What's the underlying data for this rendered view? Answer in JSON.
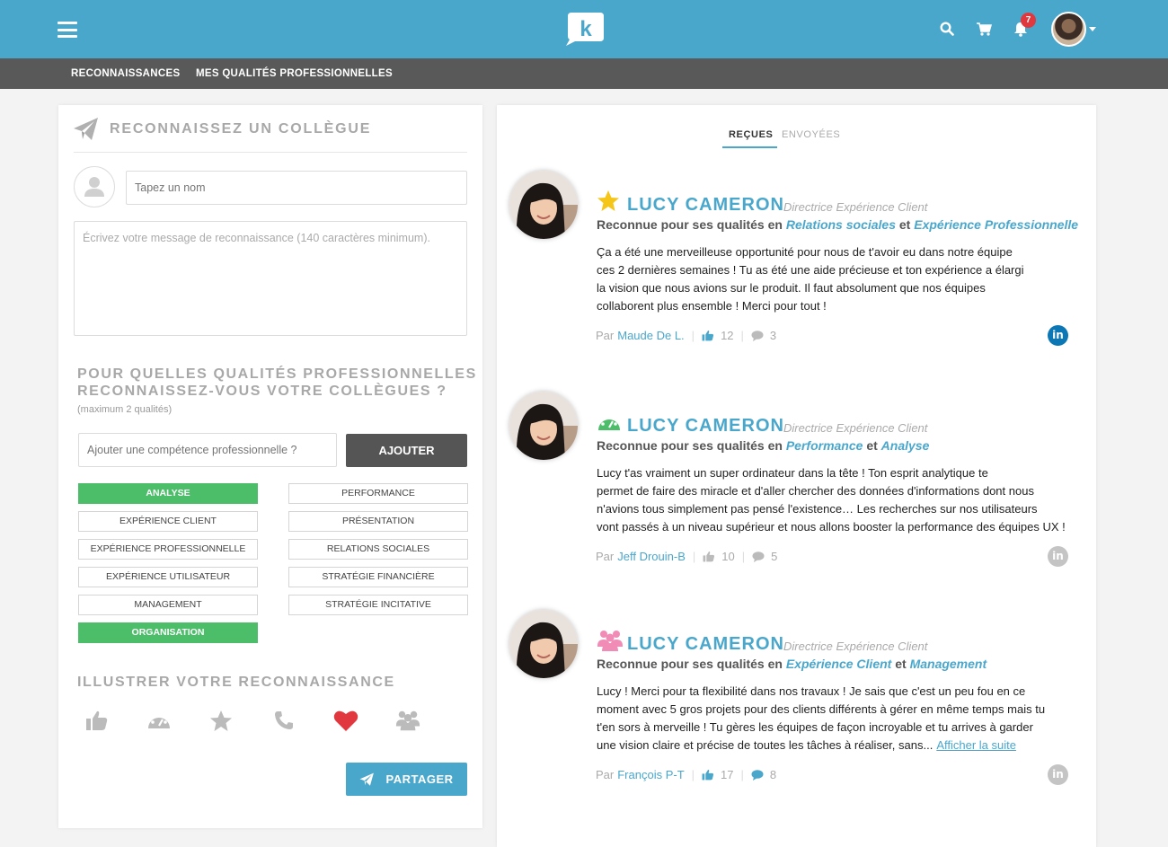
{
  "header": {
    "notifications_count": "7",
    "brand_color": "#4aa7cc",
    "logo_letter": "k"
  },
  "subnav": {
    "items": [
      "RECONNAISSANCES",
      "MES QUALITÉS PROFESSIONNELLES"
    ]
  },
  "compose": {
    "title": "RECONNAISSEZ UN COLLÈGUE",
    "name_placeholder": "Tapez un nom",
    "message_placeholder": "Écrivez votre message de reconnaissance (140 caractères minimum).",
    "qualities_title_line1": "POUR QUELLES QUALITÉS PROFESSIONNELLES",
    "qualities_title_line2": "RECONNAISSEZ-VOUS VOTRE COLLÈGUES ?",
    "qualities_note": "(maximum 2 qualités)",
    "skill_placeholder": "Ajouter une compétence professionnelle ?",
    "add_label": "AJOUTER",
    "tags_left": [
      {
        "label": "ANALYSE",
        "selected": true
      },
      {
        "label": "EXPÉRIENCE CLIENT",
        "selected": false
      },
      {
        "label": "EXPÉRIENCE PROFESSIONNELLE",
        "selected": false
      },
      {
        "label": "EXPÉRIENCE UTILISATEUR",
        "selected": false
      },
      {
        "label": "MANAGEMENT",
        "selected": false
      },
      {
        "label": "ORGANISATION",
        "selected": true
      }
    ],
    "tags_right": [
      {
        "label": "PERFORMANCE",
        "selected": false
      },
      {
        "label": "PRÉSENTATION",
        "selected": false
      },
      {
        "label": "RELATIONS SOCIALES",
        "selected": false
      },
      {
        "label": "STRATÉGIE FINANCIÈRE",
        "selected": false
      },
      {
        "label": "STRATÉGIE INCITATIVE",
        "selected": false
      }
    ],
    "illustrate_title": "ILLUSTRER VOTRE RECONNAISSANCE",
    "illustrate_icons": [
      "thumbs-up-icon",
      "gauge-icon",
      "star-icon",
      "phone-icon",
      "heart-icon",
      "group-icon"
    ],
    "illustrate_selected": "heart-icon",
    "share_label": "PARTAGER",
    "selected_color": "#4cbe6a",
    "heart_color": "#e0383e"
  },
  "feed": {
    "tabs": [
      {
        "label": "REÇUES",
        "active": true
      },
      {
        "label": "ENVOYÉES",
        "active": false
      }
    ],
    "cards": [
      {
        "icon": "star-icon",
        "icon_color": "#f5c518",
        "name": "LUCY CAMERON",
        "role": "Directrice Expérience Client",
        "sub_prefix": "Reconnue pour ses qualités en",
        "quality1": "Relations sociales",
        "conj": "et",
        "quality2": "Expérience Professionnelle",
        "body_lines": [
          "Ça a été une merveilleuse opportunité pour nous de t'avoir eu dans notre équipe",
          "ces 2 dernières semaines ! Tu as été une aide précieuse et ton expérience a élargi",
          "la vision que nous avions sur le produit. Il faut absolument que nos équipes",
          "collaborent plus ensemble ! Merci pour tout !"
        ],
        "by_label": "Par",
        "author": "Maude De L.",
        "likes": "12",
        "comments": "3",
        "liked": true,
        "commented": false,
        "linkedin_active": true
      },
      {
        "icon": "gauge-icon",
        "icon_color": "#4cbe6a",
        "name": "LUCY CAMERON",
        "role": "Directrice Expérience Client",
        "sub_prefix": "Reconnue pour ses qualités en",
        "quality1": "Performance",
        "conj": "et",
        "quality2": "Analyse",
        "body_lines": [
          "Lucy t'as vraiment un super ordinateur dans la tête ! Ton esprit analytique te",
          "permet de faire des miracle et d'aller chercher des données d'informations dont nous",
          "n'avions tous simplement pas pensé l'existence… Les recherches sur nos utilisateurs",
          "vont passés à un niveau supérieur et nous allons booster la performance des équipes UX !"
        ],
        "by_label": "Par",
        "author": "Jeff Drouin-B",
        "likes": "10",
        "comments": "5",
        "liked": false,
        "commented": false,
        "linkedin_active": false
      },
      {
        "icon": "group-icon",
        "icon_color": "#f08cb5",
        "name": "LUCY CAMERON",
        "role": "Directrice Expérience Client",
        "sub_prefix": "Reconnue pour ses qualités en",
        "quality1": "Expérience Client",
        "conj": "et",
        "quality2": "Management",
        "body_lines": [
          "Lucy ! Merci pour ta flexibilité dans nos travaux ! Je sais que c'est un peu fou en ce",
          "moment avec 5 gros projets pour des clients différents à gérer en même temps mais tu",
          "t'en sors à merveille ! Tu gères les équipes  de façon incroyable et tu arrives à garder",
          "une vision claire et précise de toutes les tâches à réaliser, sans..."
        ],
        "read_more": "Afficher la suite",
        "by_label": "Par",
        "author": "François P-T",
        "likes": "17",
        "comments": "8",
        "liked": true,
        "commented": true,
        "linkedin_active": false
      }
    ]
  }
}
